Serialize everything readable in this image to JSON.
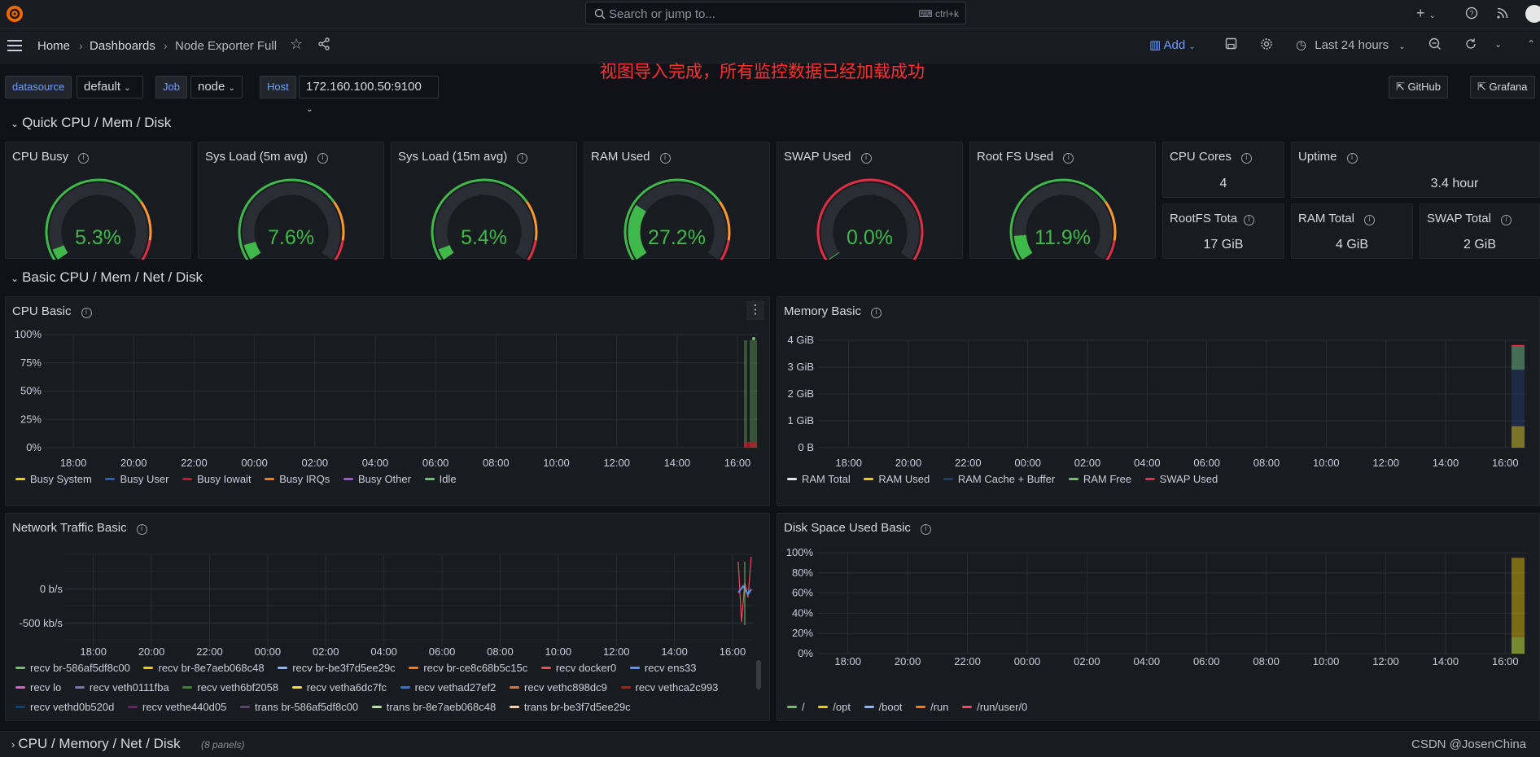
{
  "topbar": {
    "search_placeholder": "Search or jump to...",
    "search_shortcut": "ctrl+k",
    "add_menu": "+",
    "help_icon": "help-icon",
    "news_icon": "rss-icon"
  },
  "nav": {
    "breadcrumbs": [
      "Home",
      "Dashboards",
      "Node Exporter Full"
    ],
    "add_label": "Add",
    "time_range": "Last 24 hours"
  },
  "notice": "视图导入完成，所有监控数据已经加载成功",
  "variables": [
    {
      "label": "datasource",
      "value": "default"
    },
    {
      "label": "Job",
      "value": "node"
    },
    {
      "label": "Host",
      "value": "172.160.100.50:9100"
    }
  ],
  "links": [
    "GitHub",
    "Grafana"
  ],
  "rows": {
    "quick": "Quick CPU / Mem / Disk",
    "basic": "Basic CPU / Mem / Net / Disk",
    "collapsed": "CPU / Memory / Net / Disk",
    "collapsed_count": "(8 panels)"
  },
  "gauges": [
    {
      "title": "CPU Busy",
      "value": "5.3%",
      "fraction": 0.053,
      "threshold": "green-red"
    },
    {
      "title": "Sys Load (5m avg)",
      "value": "7.6%",
      "fraction": 0.076,
      "threshold": "green-red"
    },
    {
      "title": "Sys Load (15m avg)",
      "value": "5.4%",
      "fraction": 0.054,
      "threshold": "green-red"
    },
    {
      "title": "RAM Used",
      "value": "27.2%",
      "fraction": 0.272,
      "threshold": "green-red"
    },
    {
      "title": "SWAP Used",
      "value": "0.0%",
      "fraction": 0.0,
      "threshold": "red"
    },
    {
      "title": "Root FS Used",
      "value": "11.9%",
      "fraction": 0.119,
      "threshold": "green-red"
    }
  ],
  "stats": [
    {
      "title": "CPU Cores",
      "value": "4"
    },
    {
      "title": "Uptime",
      "value": "3.4 hour"
    },
    {
      "title": "RootFS Tota",
      "value": "17 GiB"
    },
    {
      "title": "RAM Total",
      "value": "4 GiB"
    },
    {
      "title": "SWAP Total",
      "value": "2 GiB"
    }
  ],
  "colors": {
    "busy_system": "#f2cc0c",
    "busy_user": "#1f60c4",
    "busy_iowait": "#c4162a",
    "busy_irqs": "#ff780a",
    "busy_other": "#a352cc",
    "idle": "#73bf69",
    "ram_total": "#e6e6e6",
    "ram_used": "#f2cc0c",
    "ram_cache": "#1f3a6e",
    "ram_free": "#73bf69",
    "swap_used": "#e02f44"
  },
  "panels": {
    "cpu_basic": {
      "title": "CPU Basic",
      "legend": [
        {
          "label": "Busy System",
          "color": "#f2cc0c"
        },
        {
          "label": "Busy User",
          "color": "#1f60c4"
        },
        {
          "label": "Busy Iowait",
          "color": "#c4162a"
        },
        {
          "label": "Busy IRQs",
          "color": "#ff780a"
        },
        {
          "label": "Busy Other",
          "color": "#a352cc"
        },
        {
          "label": "Idle",
          "color": "#73bf69"
        }
      ]
    },
    "memory_basic": {
      "title": "Memory Basic",
      "legend": [
        {
          "label": "RAM Total",
          "color": "#e6e6e6"
        },
        {
          "label": "RAM Used",
          "color": "#f2cc0c"
        },
        {
          "label": "RAM Cache + Buffer",
          "color": "#1f3a6e"
        },
        {
          "label": "RAM Free",
          "color": "#73bf69"
        },
        {
          "label": "SWAP Used",
          "color": "#e02f44"
        }
      ]
    },
    "network_basic": {
      "title": "Network Traffic Basic",
      "legend_rows": [
        [
          {
            "label": "recv br-586af5df8c00",
            "color": "#73bf69"
          },
          {
            "label": "recv br-8e7aeb068c48",
            "color": "#f2cc0c"
          },
          {
            "label": "recv br-be3f7d5ee29c",
            "color": "#8ab8ff"
          },
          {
            "label": "recv br-ce8c68b5c15c",
            "color": "#ff780a"
          },
          {
            "label": "recv docker0",
            "color": "#f2495c"
          },
          {
            "label": "recv ens33",
            "color": "#5794f2"
          }
        ],
        [
          {
            "label": "recv lo",
            "color": "#e05fcf"
          },
          {
            "label": "recv veth0111fba",
            "color": "#806eb7"
          },
          {
            "label": "recv veth6bf2058",
            "color": "#37872d"
          },
          {
            "label": "recv vetha6dc7fc",
            "color": "#fade2a"
          },
          {
            "label": "recv vethad27ef2",
            "color": "#3274d9"
          },
          {
            "label": "recv vethc898dc9",
            "color": "#e0752d"
          },
          {
            "label": "recv vethca2c993",
            "color": "#bf1b00"
          }
        ],
        [
          {
            "label": "recv vethd0b520d",
            "color": "#0a437c"
          },
          {
            "label": "recv vethe440d05",
            "color": "#6d1f62"
          },
          {
            "label": "trans br-586af5df8c00",
            "color": "#584477"
          },
          {
            "label": "trans br-8e7aeb068c48",
            "color": "#b7dbab"
          },
          {
            "label": "trans br-be3f7d5ee29c",
            "color": "#f4d598"
          }
        ]
      ]
    },
    "disk_basic": {
      "title": "Disk Space Used Basic",
      "legend": [
        {
          "label": "/",
          "color": "#73bf69"
        },
        {
          "label": "/opt",
          "color": "#f2cc0c"
        },
        {
          "label": "/boot",
          "color": "#8ab8ff"
        },
        {
          "label": "/run",
          "color": "#ff780a"
        },
        {
          "label": "/run/user/0",
          "color": "#f2495c"
        }
      ]
    }
  },
  "chart_data": [
    {
      "type": "area",
      "title": "CPU Basic",
      "x": [
        "18:00",
        "20:00",
        "22:00",
        "00:00",
        "02:00",
        "04:00",
        "06:00",
        "08:00",
        "10:00",
        "12:00",
        "14:00",
        "16:00"
      ],
      "yticks": [
        "100%",
        "75%",
        "50%",
        "25%",
        "0%"
      ],
      "ylim": [
        0,
        100
      ],
      "series": [
        {
          "name": "Busy System",
          "values": [
            null,
            null,
            null,
            null,
            null,
            null,
            null,
            null,
            null,
            null,
            null,
            2
          ]
        },
        {
          "name": "Busy User",
          "values": [
            null,
            null,
            null,
            null,
            null,
            null,
            null,
            null,
            null,
            null,
            null,
            3
          ]
        },
        {
          "name": "Idle",
          "values": [
            null,
            null,
            null,
            null,
            null,
            null,
            null,
            null,
            null,
            null,
            null,
            95
          ]
        }
      ]
    },
    {
      "type": "area",
      "title": "Memory Basic",
      "x": [
        "18:00",
        "20:00",
        "22:00",
        "00:00",
        "02:00",
        "04:00",
        "06:00",
        "08:00",
        "10:00",
        "12:00",
        "14:00",
        "16:00"
      ],
      "yticks": [
        "4 GiB",
        "3 GiB",
        "2 GiB",
        "1 GiB",
        "0 B"
      ],
      "ylim": [
        0,
        4
      ],
      "series": [
        {
          "name": "RAM Total",
          "values": [
            null,
            null,
            null,
            null,
            null,
            null,
            null,
            null,
            null,
            null,
            null,
            3.8
          ]
        },
        {
          "name": "RAM Used",
          "values": [
            null,
            null,
            null,
            null,
            null,
            null,
            null,
            null,
            null,
            null,
            null,
            0.8
          ]
        },
        {
          "name": "RAM Free",
          "values": [
            null,
            null,
            null,
            null,
            null,
            null,
            null,
            null,
            null,
            null,
            null,
            2.9
          ]
        }
      ]
    },
    {
      "type": "line",
      "title": "Network Traffic Basic",
      "x": [
        "18:00",
        "20:00",
        "22:00",
        "00:00",
        "02:00",
        "04:00",
        "06:00",
        "08:00",
        "10:00",
        "12:00",
        "14:00",
        "16:00"
      ],
      "yticks": [
        "0 b/s",
        "-500 kb/s"
      ],
      "series": []
    },
    {
      "type": "area",
      "title": "Disk Space Used Basic",
      "x": [
        "18:00",
        "20:00",
        "22:00",
        "00:00",
        "02:00",
        "04:00",
        "06:00",
        "08:00",
        "10:00",
        "12:00",
        "14:00",
        "16:00"
      ],
      "yticks": [
        "100%",
        "80%",
        "60%",
        "40%",
        "20%",
        "0%"
      ],
      "ylim": [
        0,
        100
      ],
      "series": [
        {
          "name": "/opt",
          "values": [
            null,
            null,
            null,
            null,
            null,
            null,
            null,
            null,
            null,
            null,
            null,
            95
          ]
        },
        {
          "name": "/",
          "values": [
            null,
            null,
            null,
            null,
            null,
            null,
            null,
            null,
            null,
            null,
            null,
            12
          ]
        }
      ]
    }
  ],
  "watermark": "CSDN @JosenChina"
}
